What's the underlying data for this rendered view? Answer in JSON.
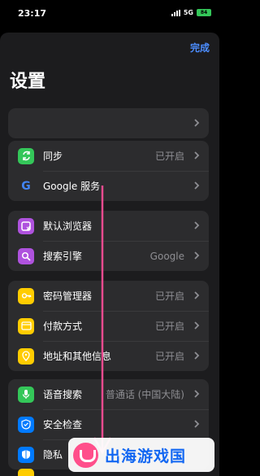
{
  "status_bar": {
    "time": "23:17",
    "network": "5G",
    "battery": "84"
  },
  "sheet": {
    "done_label": "完成",
    "title": "设置"
  },
  "groups": [
    {
      "rows": [
        {
          "label": "",
          "value": "",
          "icon": "none"
        }
      ]
    },
    {
      "rows": [
        {
          "label": "同步",
          "value": "已开启",
          "icon": "sync-icon"
        },
        {
          "label": "Google 服务",
          "value": "",
          "icon": "google-icon"
        }
      ]
    },
    {
      "rows": [
        {
          "label": "默认浏览器",
          "value": "",
          "icon": "browser-icon"
        },
        {
          "label": "搜索引擎",
          "value": "Google",
          "icon": "search-icon"
        }
      ]
    },
    {
      "rows": [
        {
          "label": "密码管理器",
          "value": "已开启",
          "icon": "key-icon"
        },
        {
          "label": "付款方式",
          "value": "已开启",
          "icon": "card-icon"
        },
        {
          "label": "地址和其他信息",
          "value": "已开启",
          "icon": "location-icon"
        }
      ]
    },
    {
      "rows": [
        {
          "label": "语音搜索",
          "value": "普通话 (中国大陆)",
          "icon": "microphone-icon"
        },
        {
          "label": "安全检查",
          "value": "",
          "icon": "shield-check-icon"
        },
        {
          "label": "隐私",
          "value": "",
          "icon": "privacy-shield-icon"
        }
      ]
    }
  ],
  "watermark": {
    "text": "出海游戏国"
  }
}
